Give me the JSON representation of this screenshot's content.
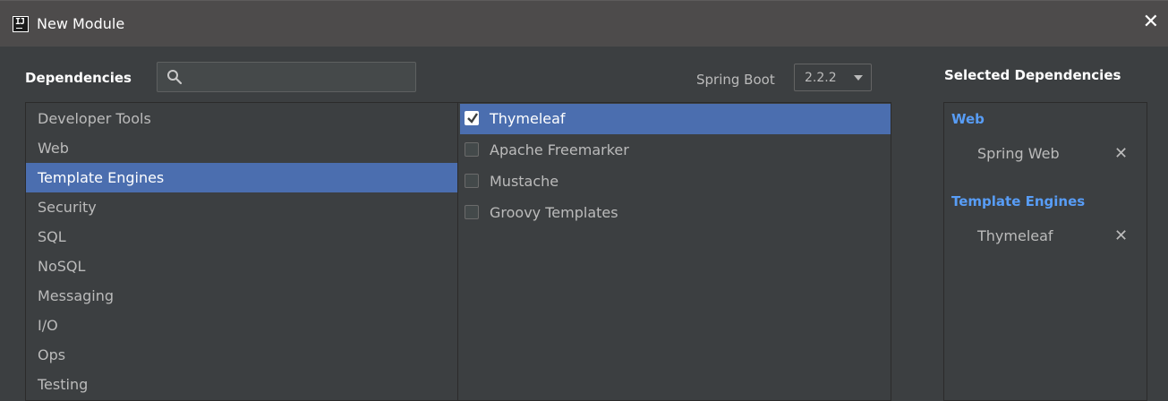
{
  "window": {
    "icon_text": "IJ",
    "title": "New Module",
    "close_glyph": "✕"
  },
  "dependencies": {
    "label": "Dependencies",
    "search_placeholder": ""
  },
  "spring_boot": {
    "label": "Spring Boot",
    "version": "2.2.2"
  },
  "categories": [
    {
      "label": "Developer Tools",
      "selected": false
    },
    {
      "label": "Web",
      "selected": false
    },
    {
      "label": "Template Engines",
      "selected": true
    },
    {
      "label": "Security",
      "selected": false
    },
    {
      "label": "SQL",
      "selected": false
    },
    {
      "label": "NoSQL",
      "selected": false
    },
    {
      "label": "Messaging",
      "selected": false
    },
    {
      "label": "I/O",
      "selected": false
    },
    {
      "label": "Ops",
      "selected": false
    },
    {
      "label": "Testing",
      "selected": false
    }
  ],
  "dependency_options": [
    {
      "label": "Thymeleaf",
      "checked": true,
      "selected": true
    },
    {
      "label": "Apache Freemarker",
      "checked": false,
      "selected": false
    },
    {
      "label": "Mustache",
      "checked": false,
      "selected": false
    },
    {
      "label": "Groovy Templates",
      "checked": false,
      "selected": false
    }
  ],
  "selected_dependencies": {
    "heading": "Selected Dependencies",
    "remove_glyph": "✕",
    "groups": [
      {
        "title": "Web",
        "items": [
          "Spring Web"
        ]
      },
      {
        "title": "Template Engines",
        "items": [
          "Thymeleaf"
        ]
      }
    ]
  },
  "colors": {
    "background": "#3c3f41",
    "titlebar": "#4d4b4b",
    "selection": "#4b6eaf",
    "group_title": "#589df6"
  }
}
